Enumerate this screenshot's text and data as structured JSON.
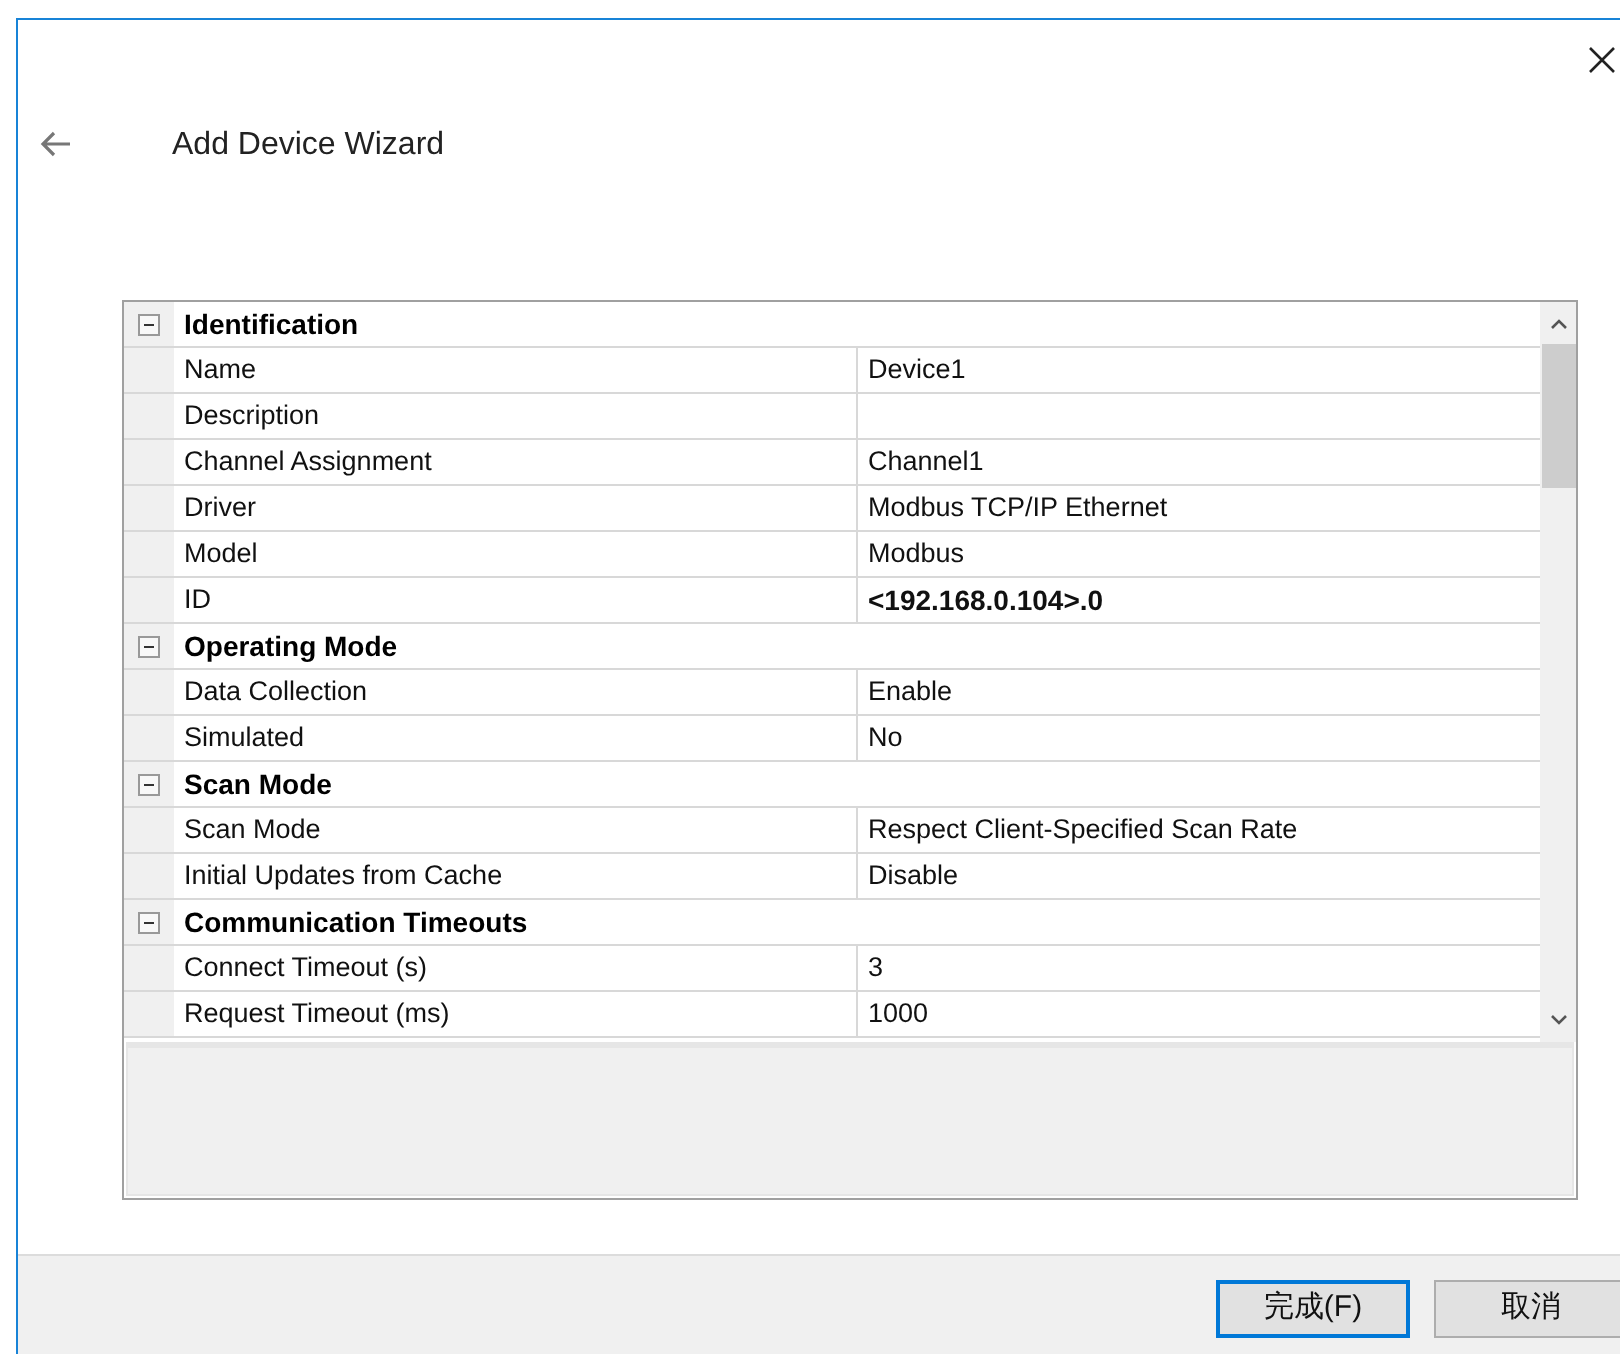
{
  "window": {
    "title": "Add Device Wizard"
  },
  "sections": [
    {
      "title": "Identification",
      "expanded": true,
      "properties": [
        {
          "name": "Name",
          "value": "Device1"
        },
        {
          "name": "Description"
        },
        {
          "name": "Channel Assignment",
          "value": "Channel1"
        },
        {
          "name": "Driver",
          "value": "Modbus TCP/IP Ethernet"
        },
        {
          "name": "Model",
          "value": "Modbus"
        },
        {
          "name": "ID",
          "value": "<192.168.0.104>.0",
          "bold": true
        }
      ]
    },
    {
      "title": "Operating Mode",
      "expanded": true,
      "properties": [
        {
          "name": "Data Collection",
          "value": "Enable"
        },
        {
          "name": "Simulated",
          "value": "No"
        }
      ]
    },
    {
      "title": "Scan Mode",
      "expanded": true,
      "properties": [
        {
          "name": "Scan Mode",
          "value": "Respect Client-Specified Scan Rate"
        },
        {
          "name": "Initial Updates from Cache",
          "value": "Disable"
        }
      ]
    },
    {
      "title": "Communication Timeouts",
      "expanded": true,
      "properties": [
        {
          "name": "Connect Timeout (s)",
          "value": "3"
        },
        {
          "name": "Request Timeout (ms)",
          "value": "1000"
        }
      ]
    }
  ],
  "buttons": [
    {
      "label": "完成(F)",
      "selected": true
    },
    {
      "label": "取消",
      "selected": false
    }
  ]
}
